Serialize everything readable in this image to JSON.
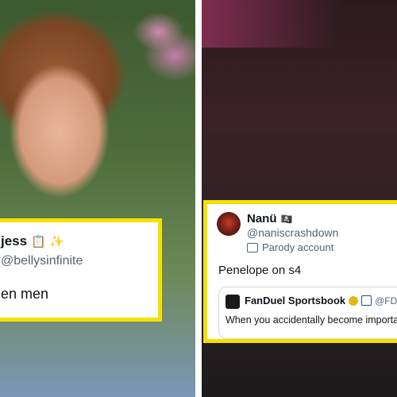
{
  "left_tweet": {
    "name": "jess",
    "emoji": "📋 ✨",
    "handle": "@bellysinfinite",
    "text": "en men"
  },
  "right_tweet": {
    "name": "Nanü",
    "name_emoji": "🏴‍☠️",
    "handle": "@naniscrashdown",
    "account_label": "Parody account",
    "text": "Penelope on s4",
    "quoted": {
      "name": "FanDuel Sportsbook",
      "handle": "@FDSp",
      "text": "When you accidentally become importa"
    }
  },
  "colors": {
    "highlight_border": "#f5e100",
    "verified_gold": "#e2b719",
    "text_primary": "#0f1419",
    "text_secondary": "#536471"
  }
}
